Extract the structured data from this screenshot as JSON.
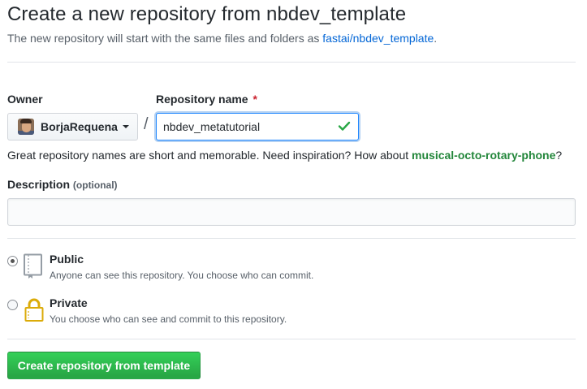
{
  "header": {
    "title": "Create a new repository from nbdev_template",
    "subtitle_prefix": "The new repository will start with the same files and folders as ",
    "template_link": "fastai/nbdev_template",
    "subtitle_suffix": "."
  },
  "owner": {
    "label": "Owner",
    "selected": "BorjaRequena"
  },
  "repository": {
    "label": "Repository name",
    "required_marker": "*",
    "separator": "/",
    "value": "nbdev_metatutorial",
    "valid": true
  },
  "hint": {
    "prefix": "Great repository names are short and memorable. Need inspiration? How about ",
    "suggestion": "musical-octo-rotary-phone",
    "suffix": "?"
  },
  "description": {
    "label": "Description",
    "optional_note": "(optional)",
    "value": ""
  },
  "visibility": {
    "selected": "public",
    "options": [
      {
        "id": "public",
        "title": "Public",
        "description": "Anyone can see this repository. You choose who can commit.",
        "icon": "book-icon"
      },
      {
        "id": "private",
        "title": "Private",
        "description": "You choose who can see and commit to this repository.",
        "icon": "lock-icon"
      }
    ]
  },
  "submit": {
    "label": "Create repository from template"
  },
  "colors": {
    "link": "#0366d6",
    "suggestion": "#22863a",
    "required": "#cb2431",
    "primary_button": "#28a745",
    "focus_border": "#2188ff"
  }
}
